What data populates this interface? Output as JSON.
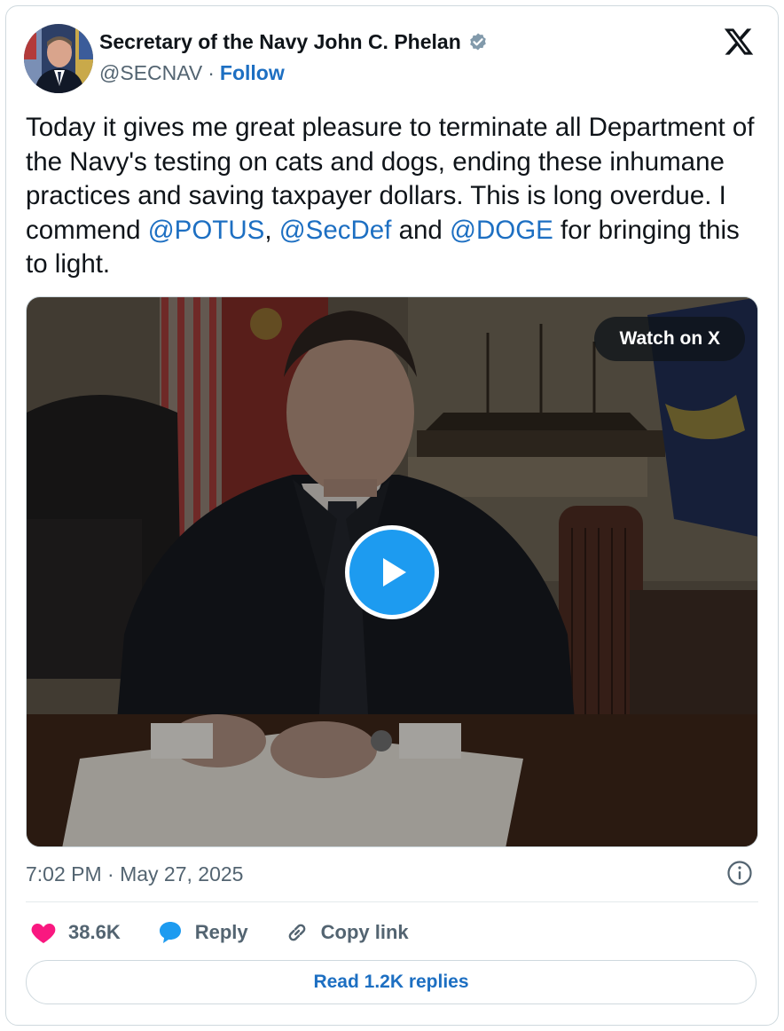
{
  "author": {
    "name": "Secretary of the Navy John C. Phelan",
    "handle": "@SECNAV",
    "separator": "·",
    "follow_label": "Follow",
    "verified_badge": "verified-badge-icon"
  },
  "tweet": {
    "text_1": "Today it gives me great pleasure to terminate all Department of the Navy's testing on cats and dogs, ending these inhumane practices and saving taxpayer dollars. This is long overdue. I commend ",
    "mention_1": "@POTUS",
    "text_2": ", ",
    "mention_2": "@SecDef",
    "text_3": " and ",
    "mention_3": "@DOGE",
    "text_4": " for bringing this to light."
  },
  "media": {
    "watch_label": "Watch on X",
    "play_icon": "play-icon"
  },
  "meta": {
    "timestamp": "7:02 PM · May 27, 2025"
  },
  "actions": {
    "likes": "38.6K",
    "reply_label": "Reply",
    "copy_label": "Copy link"
  },
  "read_replies_label": "Read 1.2K replies",
  "colors": {
    "link": "#1d6fc2",
    "like": "#f91880",
    "reply": "#1d9bf0",
    "muted": "#536471"
  }
}
